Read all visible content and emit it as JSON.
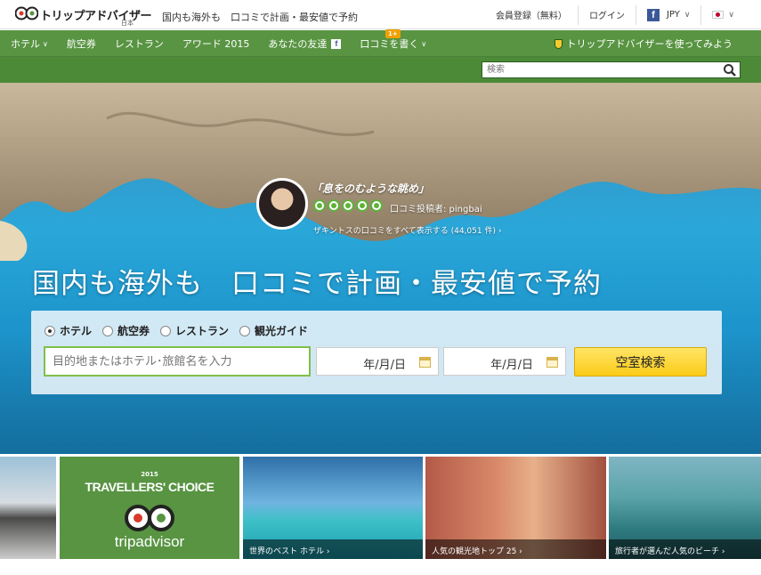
{
  "header": {
    "logo_text": "トリップアドバイザー",
    "logo_sub": "日本",
    "tagline": "国内も海外も　口コミで計画・最安値で予約",
    "register": "会員登録（無料）",
    "login": "ログイン",
    "facebook_icon": "f",
    "currency": "JPY",
    "flag": "japan-flag"
  },
  "nav": {
    "items": [
      {
        "label": "ホテル"
      },
      {
        "label": "航空券"
      },
      {
        "label": "レストラン"
      },
      {
        "label": "アワード 2015"
      },
      {
        "label": "あなたの友達"
      },
      {
        "label": "口コミを書く"
      }
    ],
    "badge": "1+",
    "try_link": "トリップアドバイザーを使ってみよう"
  },
  "site_search": {
    "placeholder": "検索"
  },
  "hero": {
    "quote": "「息をのむような眺め」",
    "bubble_rating": 5,
    "reviewer": "口コミ投稿者: pingbai",
    "all_reviews": "ザキントスの口コミをすべて表示する (44,051 件) ›",
    "headline": "国内も海外も　口コミで計画・最安値で予約"
  },
  "search_panel": {
    "options": [
      "ホテル",
      "航空券",
      "レストラン",
      "観光ガイド"
    ],
    "selected": "ホテル",
    "destination_placeholder": "目的地またはホテル･旅館名を入力",
    "checkin": "年/月/日",
    "checkout": "年/月/日",
    "button": "空室検索"
  },
  "tiles": {
    "tc_line1": "2015",
    "tc_line2": "TRAVELLERS' CHOICE",
    "tc_brand": "tripadvisor",
    "captions": [
      "世界のベスト ホテル ›",
      "人気の観光地トップ 25 ›",
      "旅行者が選んだ人気のビーチ ›"
    ]
  },
  "colors": {
    "brand_green": "#589442",
    "button_yellow": "#fbcb17",
    "bubble_green": "#5fb13a"
  }
}
